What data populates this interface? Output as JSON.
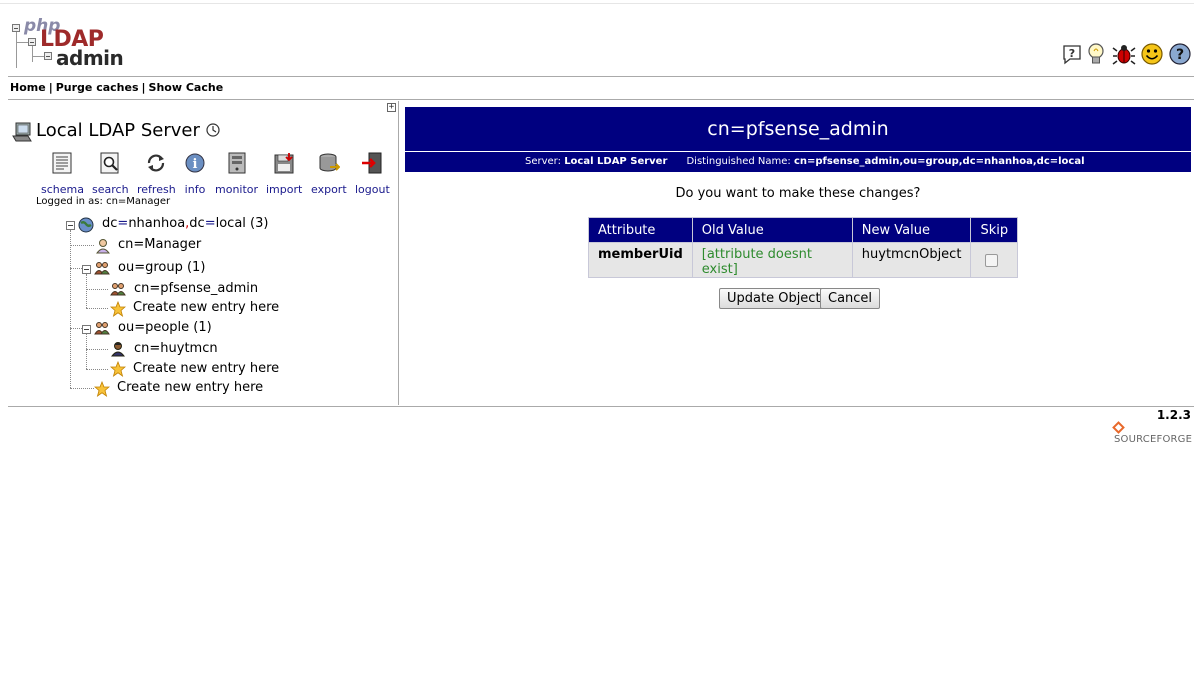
{
  "logo": {
    "php": "php",
    "ldap": "LDAP",
    "admin": "admin"
  },
  "menu": {
    "items": [
      "Home",
      "Purge caches",
      "Show Cache"
    ],
    "separator": "|"
  },
  "header_icons": [
    "help-icon",
    "lightbulb-icon",
    "bug-icon",
    "smiley-icon",
    "question-icon"
  ],
  "server": {
    "name": "Local LDAP Server"
  },
  "toolbar": [
    {
      "label": "schema",
      "icon": "schema-icon"
    },
    {
      "label": "search",
      "icon": "search-icon"
    },
    {
      "label": "refresh",
      "icon": "refresh-icon"
    },
    {
      "label": "info",
      "icon": "info-icon"
    },
    {
      "label": "monitor",
      "icon": "monitor-icon"
    },
    {
      "label": "import",
      "icon": "import-icon"
    },
    {
      "label": "export",
      "icon": "export-icon"
    },
    {
      "label": "logout",
      "icon": "logout-icon"
    }
  ],
  "logged_in": "Logged in as: cn=Manager",
  "tree": {
    "root": {
      "part1": "dc",
      "eq": "=",
      "part2": "nhanhoa",
      "comma": ",",
      "part3": "dc",
      "part4": "local",
      "count": "(3)"
    },
    "manager": "cn=Manager",
    "group": "ou=group (1)",
    "pfsense_admin": "cn=pfsense_admin",
    "create_group": "Create new entry here",
    "people": "ou=people (1)",
    "huytmcn": "cn=huytmcn",
    "create_people": "Create new entry here",
    "create_root": "Create new entry here"
  },
  "entry": {
    "title": "cn=pfsense_admin",
    "server_label": "Server:",
    "server_value": "Local LDAP Server",
    "dn_label": "Distinguished Name:",
    "dn_value": "cn=pfsense_admin,ou=group,dc=nhanhoa,dc=local"
  },
  "confirm": {
    "question": "Do you want to make these changes?",
    "headers": [
      "Attribute",
      "Old Value",
      "New Value",
      "Skip"
    ],
    "rows": [
      {
        "attribute": "memberUid",
        "old": "[attribute doesnt exist]",
        "new": "huytmcnObject",
        "skip": false
      }
    ],
    "update_button": "Update Object",
    "cancel_button": "Cancel"
  },
  "footer": {
    "version": "1.2.3",
    "sourceforge": "SOURCEFORGE"
  },
  "colors": {
    "header_bg": "#000080",
    "old_value": "#2e8b2e",
    "link": "#1a1a8c"
  }
}
